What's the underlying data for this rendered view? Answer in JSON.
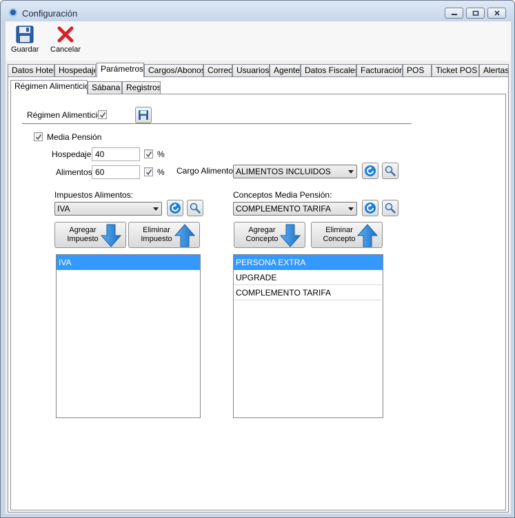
{
  "window": {
    "title": "Configuración"
  },
  "toolbar": {
    "save_label": "Guardar",
    "cancel_label": "Cancelar"
  },
  "tabs": [
    {
      "label": "Datos Hotel"
    },
    {
      "label": "Hospedaje"
    },
    {
      "label": "Parámetros"
    },
    {
      "label": "Cargos/Abonos"
    },
    {
      "label": "Correo"
    },
    {
      "label": "Usuarios"
    },
    {
      "label": "Agente"
    },
    {
      "label": "Datos Fiscales"
    },
    {
      "label": "Facturación"
    },
    {
      "label": "POS"
    },
    {
      "label": "Ticket POS"
    },
    {
      "label": "Alertas"
    }
  ],
  "subtabs": [
    {
      "label": "Régimen Alimenticio"
    },
    {
      "label": "Sábana"
    },
    {
      "label": "Registros"
    }
  ],
  "regimen": {
    "label": "Régimen Alimenticio",
    "checked": true,
    "media_pension_label": "Media Pensión",
    "media_pension_checked": true,
    "hospedaje_label": "Hospedaje",
    "hospedaje_value": "40",
    "hospedaje_pct_checked": true,
    "alimentos_label": "Alimentos",
    "alimentos_value": "60",
    "alimentos_pct_checked": true,
    "percent_symbol": "%",
    "cargo_label": "Cargo Alimento",
    "cargo_value": "ALIMENTOS INCLUIDOS"
  },
  "impuestos": {
    "label": "Impuestos Alimentos:",
    "selected": "IVA",
    "add_label_line1": "Agregar",
    "add_label_line2": "Impuesto",
    "remove_label_line1": "Eliminar",
    "remove_label_line2": "Impuesto",
    "items": [
      "IVA"
    ]
  },
  "conceptos": {
    "label": "Conceptos Media Pensión:",
    "selected": "COMPLEMENTO TARIFA",
    "add_label_line1": "Agregar",
    "add_label_line2": "Concepto",
    "remove_label_line1": "Eliminar",
    "remove_label_line2": "Concepto",
    "items": [
      "PERSONA EXTRA",
      "UPGRADE",
      "COMPLEMENTO TARIFA"
    ]
  },
  "colors": {
    "selection": "#3399ff",
    "arrow_blue": "#1e7fd8",
    "cancel_red": "#d8202a"
  }
}
